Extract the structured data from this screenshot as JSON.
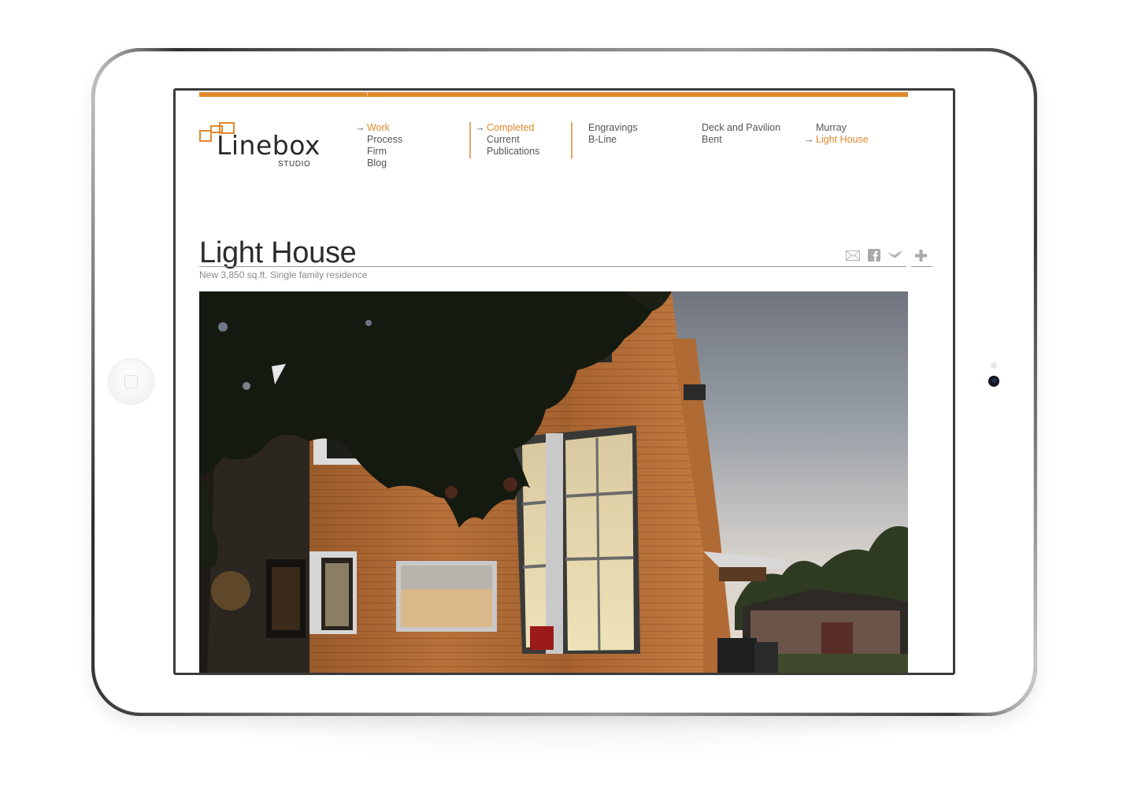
{
  "device": {
    "type": "tablet",
    "orientation": "landscape"
  },
  "site": {
    "brand": {
      "name": "Linebox",
      "tagline": "STUDIO",
      "accent_color": "#e0882c"
    },
    "nav": {
      "primary": [
        {
          "label": "Work",
          "active": true
        },
        {
          "label": "Process",
          "active": false
        },
        {
          "label": "Firm",
          "active": false
        },
        {
          "label": "Blog",
          "active": false
        }
      ],
      "status": [
        {
          "label": "Completed",
          "active": true
        },
        {
          "label": "Current",
          "active": false
        },
        {
          "label": "Publications",
          "active": false
        }
      ],
      "projects_col1": [
        {
          "label": "Engravings",
          "active": false
        },
        {
          "label": "B-Line",
          "active": false
        }
      ],
      "projects_col2": [
        {
          "label": "Deck and Pavilion",
          "active": false
        },
        {
          "label": "Bent",
          "active": false
        }
      ],
      "projects_col3": [
        {
          "label": "Murray",
          "active": false
        },
        {
          "label": "Light House",
          "active": true
        }
      ],
      "arrow_glyph": "→"
    },
    "page": {
      "title": "Light House",
      "subtitle": "New 3,850 sq.ft. Single family residence",
      "share": [
        {
          "icon": "email-icon",
          "label": "Email"
        },
        {
          "icon": "facebook-icon",
          "label": "Facebook"
        },
        {
          "icon": "twitter-icon",
          "label": "Twitter"
        },
        {
          "icon": "plus-icon",
          "label": "More"
        }
      ],
      "hero_alt": "Modern cedar-clad house with large glass windows at dusk under a tree canopy"
    }
  }
}
